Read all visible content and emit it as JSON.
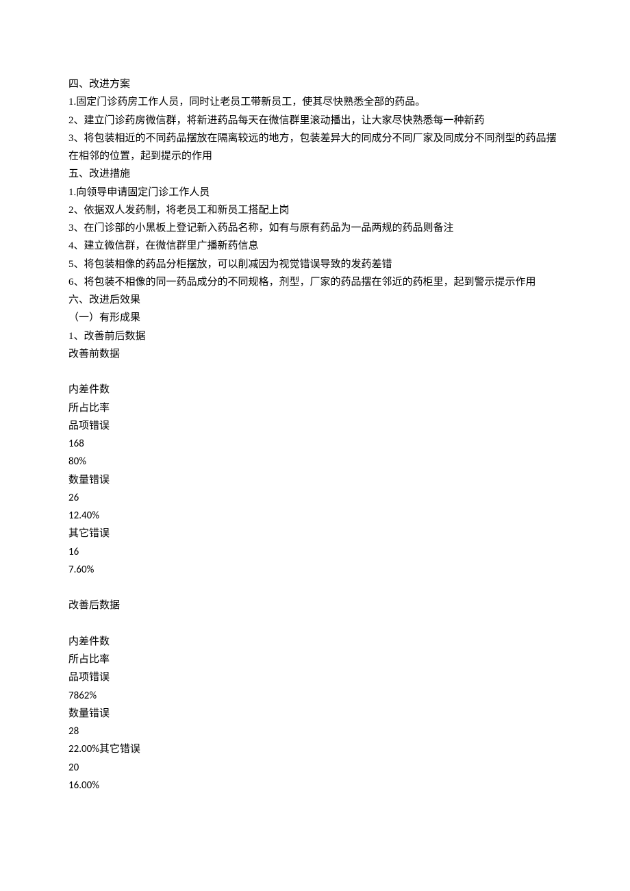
{
  "sec4": {
    "heading": "四、改进方案",
    "p1": "1.固定门诊药房工作人员，同时让老员工带新员工，使其尽快熟悉全部的药品。",
    "p2": "2、建立门诊药房微信群，将新进药品每天在微信群里滚动播出，让大家尽快熟悉每一种新药",
    "p3": "3、将包装相近的不同药品摆放在隔离较远的地方，包装差异大的同成分不同厂家及同成分不同剂型的药品摆在相邻的位置，起到提示的作用"
  },
  "sec5": {
    "heading": "五、改进措施",
    "p1": "1.向领导申请固定门诊工作人员",
    "p2": "2、依据双人发药制，将老员工和新员工搭配上岗",
    "p3": "3、在门诊部的小黑板上登记新入药品名称，如有与原有药品为一品两规的药品则备注",
    "p4": "4、建立微信群，在微信群里广播新药信息",
    "p5": "5、将包装相像的药品分柜摆放，可以削减因为视觉错误导致的发药差错",
    "p6": "6、将包装不相像的同一药品成分的不同规格，剂型，厂家的药品摆在邻近的药柜里，起到警示提示作用"
  },
  "sec6": {
    "heading": "六、改进后效果",
    "sub1": "（一）有形成果",
    "p1": "1、改善前后数据",
    "before": {
      "title": "改善前数据",
      "l1": "内差件数",
      "l2": "所占比率",
      "l3": "品项错误",
      "l4": "168",
      "l5": "80%",
      "l6": "数量错误",
      "l7": "26",
      "l8": "12.40%",
      "l9": "其它错误",
      "l10": "16",
      "l11": "7.60%"
    },
    "after": {
      "title": "改善后数据",
      "l1": "内差件数",
      "l2": "所占比率",
      "l3": "品项错误",
      "l4": "7862%",
      "l5": "数量错误",
      "l6": "28",
      "l7a": "22.00%",
      "l7b": "其它错误",
      "l8": "20",
      "l9": "16.00%"
    }
  }
}
